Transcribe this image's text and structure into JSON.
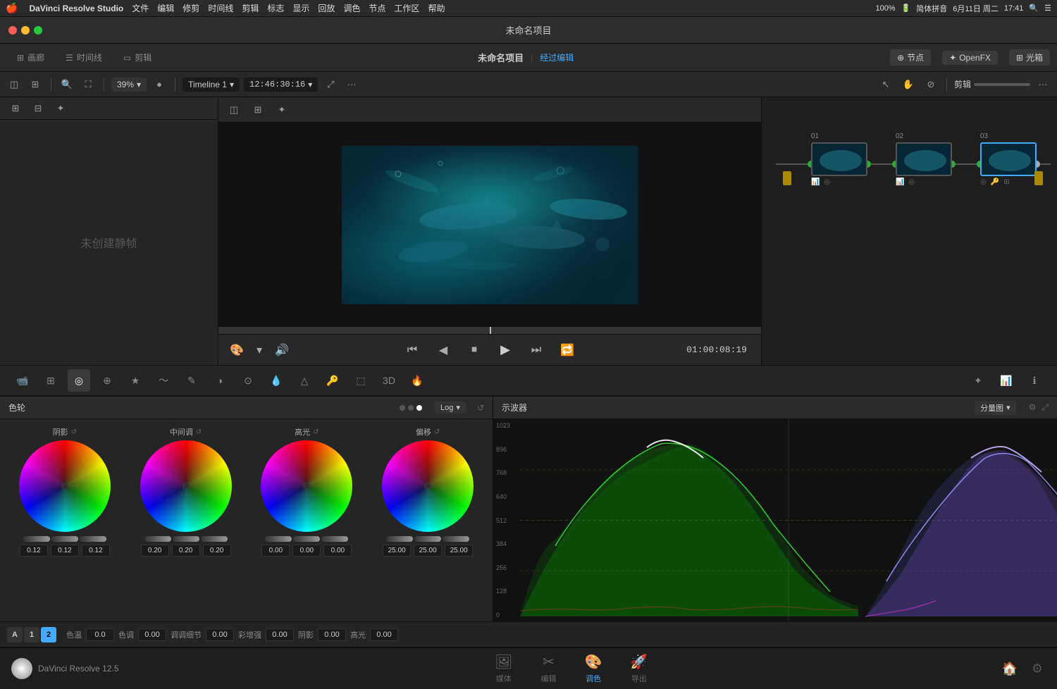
{
  "menubar": {
    "apple": "🍎",
    "app_name": "DaVinci Resolve Studio",
    "menus": [
      "文件",
      "编辑",
      "修剪",
      "时间线",
      "剪辑",
      "标志",
      "显示",
      "回放",
      "调色",
      "节点",
      "工作区",
      "帮助"
    ],
    "right": [
      "100%",
      "🔋",
      "简体拼音",
      "6月11日 周二",
      "17:41"
    ]
  },
  "titlebar": {
    "title": "未命名项目"
  },
  "appbar": {
    "tabs": [
      {
        "label": "画廊",
        "icon": "⊞",
        "active": false
      },
      {
        "label": "时间线",
        "icon": "☰",
        "active": false
      },
      {
        "label": "剪辑",
        "icon": "▭",
        "active": false
      }
    ],
    "title": "未命名项目",
    "edited_label": "经过编辑",
    "right_buttons": [
      {
        "label": "节点"
      },
      {
        "label": "OpenFX"
      },
      {
        "label": "光箱"
      }
    ]
  },
  "toolbar": {
    "zoom_level": "39%",
    "timeline_name": "Timeline 1",
    "timecode": "12:46:30:16",
    "more_btn": "···"
  },
  "video_toolbar": {
    "icons": [
      "⊞",
      "▦",
      "✦"
    ]
  },
  "playback": {
    "timecode": "01:00:08:19"
  },
  "left_panel": {
    "placeholder": "未创建静帧"
  },
  "nodes": {
    "items": [
      {
        "label": "01",
        "active": false
      },
      {
        "label": "02",
        "active": false
      },
      {
        "label": "03",
        "active": true
      }
    ]
  },
  "tools": {
    "buttons": [
      {
        "icon": "📹",
        "tooltip": "摄像机",
        "active": false
      },
      {
        "icon": "⊞",
        "tooltip": "",
        "active": false
      },
      {
        "icon": "◎",
        "tooltip": "",
        "active": true
      },
      {
        "icon": "⊕",
        "tooltip": "",
        "active": false
      },
      {
        "icon": "★",
        "tooltip": "",
        "active": false
      },
      {
        "icon": "〜",
        "tooltip": "",
        "active": false
      },
      {
        "icon": "✎",
        "tooltip": "",
        "active": false
      },
      {
        "icon": "◑",
        "tooltip": "",
        "active": false
      },
      {
        "icon": "⊙",
        "tooltip": "",
        "active": false
      },
      {
        "icon": "💧",
        "tooltip": "",
        "active": false
      },
      {
        "icon": "△",
        "tooltip": "",
        "active": false
      },
      {
        "icon": "🔑",
        "tooltip": "",
        "active": false
      },
      {
        "icon": "⬚",
        "tooltip": "",
        "active": false
      },
      {
        "icon": "3D",
        "tooltip": "",
        "active": false
      },
      {
        "icon": "🔥",
        "tooltip": "",
        "active": false
      }
    ],
    "right_buttons": [
      {
        "icon": "✦",
        "tooltip": ""
      },
      {
        "icon": "📊",
        "tooltip": ""
      }
    ],
    "info_btn": "ℹ"
  },
  "color_wheels": {
    "title": "色轮",
    "mode": "Log",
    "wheels": [
      {
        "label": "阴影",
        "values": [
          "0.12",
          "0.12",
          "0.12"
        ]
      },
      {
        "label": "中间调",
        "values": [
          "0.20",
          "0.20",
          "0.20"
        ]
      },
      {
        "label": "高光",
        "values": [
          "0.00",
          "0.00",
          "0.00"
        ]
      },
      {
        "label": "偏移",
        "values": [
          "25.00",
          "25.00",
          "25.00"
        ]
      }
    ]
  },
  "waveform": {
    "title": "示波器",
    "mode": "分量图",
    "labels": [
      "1023",
      "896",
      "768",
      "640",
      "512",
      "384",
      "256",
      "128",
      "0"
    ],
    "grid_positions": [
      "0%",
      "12.5%",
      "25%",
      "37.5%",
      "50%",
      "62.5%",
      "75%",
      "87.5%",
      "100%"
    ]
  },
  "params_bar": {
    "buttons": [
      "A",
      "1",
      "2"
    ],
    "params": [
      {
        "label": "色温",
        "value": "0.0"
      },
      {
        "label": "色调",
        "value": "0.00"
      },
      {
        "label": "调调细节",
        "value": "0.00"
      },
      {
        "label": "彩增强",
        "value": "0.00"
      },
      {
        "label": "阴影",
        "value": "0.00"
      },
      {
        "label": "高光",
        "value": "0.00"
      }
    ],
    "last_value": "0.00"
  },
  "app_nav": {
    "items": [
      {
        "label": "媒体",
        "icon": "🖼",
        "active": false
      },
      {
        "label": "编辑",
        "icon": "⬚",
        "active": false
      },
      {
        "label": "调色",
        "icon": "🎨",
        "active": true
      },
      {
        "label": "导出",
        "icon": "🚀",
        "active": false
      }
    ],
    "right": [
      {
        "icon": "🏠"
      },
      {
        "icon": "⚙"
      }
    ]
  },
  "davinci_brand": "DaVinci Resolve 12.5"
}
